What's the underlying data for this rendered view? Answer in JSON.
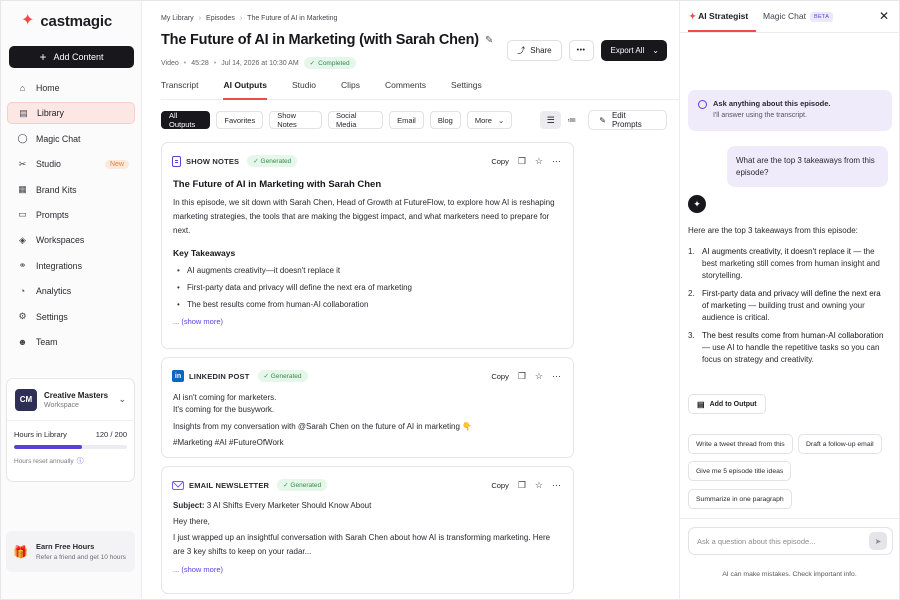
{
  "brand": {
    "name": "castmagic",
    "accent": "#ef4b4b",
    "purple": "#5b3fd8"
  },
  "sidebar": {
    "add_label": "Add Content",
    "items": [
      {
        "label": "Home",
        "icon": "home-icon",
        "glyph": "⌂"
      },
      {
        "label": "Library",
        "icon": "library-icon",
        "glyph": "▤",
        "active": true
      },
      {
        "label": "Magic Chat",
        "icon": "chat-icon",
        "glyph": "◯"
      },
      {
        "label": "Studio",
        "icon": "studio-icon",
        "glyph": "✂",
        "badge": "New"
      },
      {
        "label": "Brand Kits",
        "icon": "brand-kit-icon",
        "glyph": "▦"
      },
      {
        "label": "Prompts",
        "icon": "prompts-icon",
        "glyph": "▭"
      },
      {
        "label": "Workspaces",
        "icon": "workspaces-icon",
        "glyph": "◈"
      },
      {
        "label": "Integrations",
        "icon": "integrations-icon",
        "glyph": "⚭"
      },
      {
        "label": "Analytics",
        "icon": "analytics-icon",
        "glyph": "◔"
      },
      {
        "label": "Settings",
        "icon": "gear-icon",
        "glyph": "⚙"
      },
      {
        "label": "Team",
        "icon": "team-icon",
        "glyph": "☻"
      }
    ],
    "workspace": {
      "initials": "CM",
      "name": "Creative Masters",
      "sub": "Workspace",
      "hours_label": "Hours in Library",
      "hours_value": "120 / 200",
      "hours_fraction": 0.6,
      "hours_note": "Hours reset annually"
    },
    "earn": {
      "title": "Earn Free Hours",
      "sub": "Refer a friend and get 10 hours"
    }
  },
  "main": {
    "breadcrumb": [
      "My Library",
      "Episodes",
      "The Future of AI in Marketing"
    ],
    "title": "The Future of AI in Marketing (with Sarah Chen)",
    "meta": {
      "type": "Video",
      "duration": "45:28",
      "date": "Jul 14, 2026 at 10:30 AM",
      "status": "Completed"
    },
    "share_label": "Share",
    "more_label": "•••",
    "export_label": "Export All",
    "tabs": [
      "Transcript",
      "AI Outputs",
      "Studio",
      "Clips",
      "Comments",
      "Settings"
    ],
    "active_tab": "AI Outputs",
    "filters": [
      "All Outputs",
      "Favorites",
      "Show Notes",
      "Social Media",
      "Email",
      "Blog",
      "More"
    ],
    "edit_prompts_label": "Edit Prompts",
    "copy_label": "Copy",
    "generated_label": "Generated",
    "show_more_label": "... (show more)",
    "show_notes": {
      "type": "SHOW NOTES",
      "heading": "The Future of AI in Marketing with Sarah Chen",
      "body": "In this episode, we sit down with Sarah Chen, Head of Growth at FutureFlow, to explore how AI is reshaping marketing strategies, the tools that are making the biggest impact, and what marketers need to prepare for next.",
      "takeaways_title": "Key Takeaways",
      "takeaways": [
        "AI augments creativity—it doesn't replace it",
        "First-party data and privacy will define the next era of marketing",
        "The best results come from human-AI collaboration"
      ]
    },
    "linkedin": {
      "type": "LINKEDIN POST",
      "line1": "AI isn't coming for marketers.",
      "line2": "It's coming for the busywork.",
      "line3": "Insights from my conversation with @Sarah Chen on the future of AI in marketing 👇",
      "hashtags": "#Marketing #AI #FutureOfWork"
    },
    "newsletter": {
      "type": "EMAIL NEWSLETTER",
      "subject_label": "Subject:",
      "subject": "3 AI Shifts Every Marketer Should Know About",
      "greeting": "Hey there,",
      "body": "I just wrapped up an insightful conversation with Sarah Chen about how AI is transforming marketing. Here are 3 key shifts to keep on your radar..."
    }
  },
  "panel": {
    "tab_active": "AI Strategist",
    "tab_other": "Magic Chat",
    "beta": "BETA",
    "ask_title": "Ask anything about this episode.",
    "ask_sub": "I'll answer using the transcript.",
    "user_question": "What are the top 3 takeaways from this episode?",
    "answer_intro": "Here are the top 3 takeaways from this episode:",
    "answers": [
      {
        "num": "1.",
        "lead": "AI augments creativity, it doesn't replace it",
        "rest": " — the best marketing still comes from human insight and storytelling."
      },
      {
        "num": "2.",
        "lead": "First-party data and privacy will define the next era of marketing",
        "rest": " — building trust and owning your audience is critical."
      },
      {
        "num": "3.",
        "lead": "The best results come from human-AI collaboration",
        "rest": " — use AI to handle the repetitive tasks so you can focus on strategy and creativity."
      }
    ],
    "add_to_output": "Add to Output",
    "suggestions": [
      "Write a tweet thread from this",
      "Draft a follow-up email",
      "Give me 5 episode title ideas",
      "Summarize in one paragraph"
    ],
    "input_placeholder": "Ask a question about this episode...",
    "disclaimer": "AI can make mistakes. Check important info."
  }
}
